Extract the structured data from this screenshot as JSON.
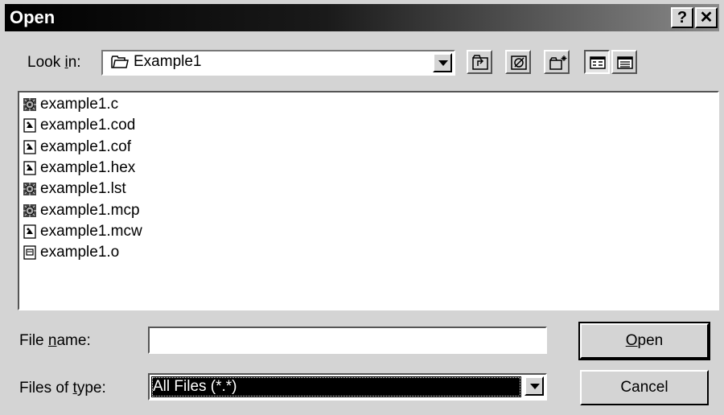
{
  "window": {
    "title": "Open",
    "help_button": "?",
    "close_button": "✕"
  },
  "look_in": {
    "label_pre": "Look ",
    "label_accel": "i",
    "label_post": "n:",
    "value": "Example1"
  },
  "toolbar": {
    "buttons": [
      "up-one-level-icon",
      "desktop-icon",
      "new-folder-icon",
      "list-view-icon",
      "details-view-icon"
    ]
  },
  "files": [
    {
      "name": "example1.c",
      "icon": "gear-file-icon"
    },
    {
      "name": "example1.cod",
      "icon": "document-file-icon"
    },
    {
      "name": "example1.cof",
      "icon": "document-file-icon"
    },
    {
      "name": "example1.hex",
      "icon": "document-file-icon"
    },
    {
      "name": "example1.lst",
      "icon": "gear-file-icon"
    },
    {
      "name": "example1.mcp",
      "icon": "gear-file-icon"
    },
    {
      "name": "example1.mcw",
      "icon": "document-file-icon"
    },
    {
      "name": "example1.o",
      "icon": "object-file-icon"
    }
  ],
  "file_name": {
    "label_pre": "File ",
    "label_accel": "n",
    "label_post": "ame:",
    "value": ""
  },
  "files_of_type": {
    "label_pre": "Files of ",
    "label_accel": "t",
    "label_post": "ype:",
    "value": "All Files (*.*)"
  },
  "buttons": {
    "open_accel": "O",
    "open_rest": "pen",
    "cancel": "Cancel"
  }
}
